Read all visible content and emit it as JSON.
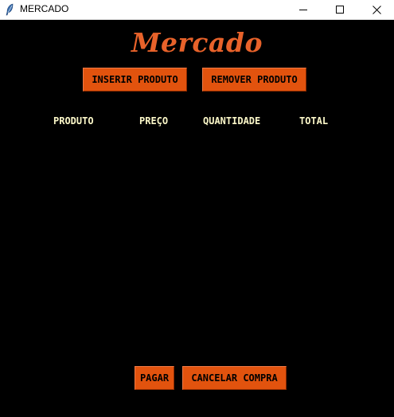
{
  "window": {
    "title": "MERCADO",
    "icon": "feather-icon"
  },
  "header": {
    "title": "Mercado"
  },
  "toolbar": {
    "insert_label": "INSERIR PRODUTO",
    "remove_label": "REMOVER PRODUTO"
  },
  "table": {
    "columns": [
      "PRODUTO",
      "PREÇO",
      "QUANTIDADE",
      "TOTAL"
    ]
  },
  "footer": {
    "pay_label": "PAGAR",
    "cancel_label": "CANCELAR COMPRA"
  },
  "colors": {
    "accent": "#e2530e",
    "title": "#e8622a",
    "column_text": "#fbf7c8",
    "background": "#000000"
  }
}
